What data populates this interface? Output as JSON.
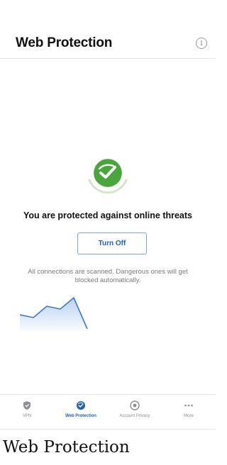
{
  "header": {
    "title": "Web Protection",
    "info_label": "i"
  },
  "status": {
    "title": "You are protected against online threats",
    "description": "All connections are scanned. Dangerous ones will get blocked automatically.",
    "turn_off_label": "Turn Off",
    "icon": "shield-check-icon",
    "accent_color": "#4aa63c"
  },
  "chart_data": {
    "type": "area",
    "series": [
      {
        "values": [
          6,
          5,
          9,
          8,
          12,
          1
        ]
      }
    ],
    "color": "#3a7bd5"
  },
  "tab_bar": {
    "active_color": "#1f5fbf",
    "inactive_color": "#8e8e93",
    "tabs": [
      {
        "label": "VPN",
        "icon": "vpn-shield-icon",
        "active": false
      },
      {
        "label": "Web Protection",
        "icon": "web-protection-globe-icon",
        "active": true
      },
      {
        "label": "Account Privacy",
        "icon": "account-privacy-eye-icon",
        "active": false
      },
      {
        "label": "More",
        "icon": "more-dots-icon",
        "active": false
      }
    ]
  },
  "caption": "Web Protection"
}
